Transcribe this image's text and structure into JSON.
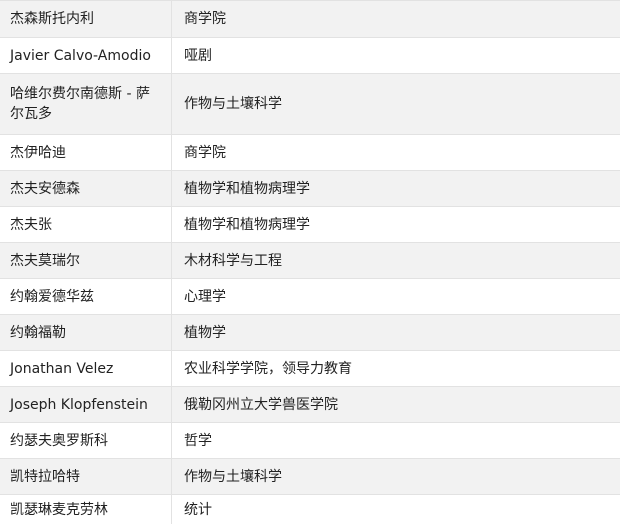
{
  "table": {
    "rows": [
      {
        "name": "杰森斯托内利",
        "dept": "商学院"
      },
      {
        "name": "Javier Calvo-Amodio",
        "dept": "哑剧"
      },
      {
        "name": "哈维尔费尔南德斯 - 萨尔瓦多",
        "dept": "作物与土壤科学"
      },
      {
        "name": "杰伊哈迪",
        "dept": "商学院"
      },
      {
        "name": "杰夫安德森",
        "dept": "植物学和植物病理学"
      },
      {
        "name": "杰夫张",
        "dept": "植物学和植物病理学"
      },
      {
        "name": "杰夫莫瑞尔",
        "dept": "木材科学与工程"
      },
      {
        "name": "约翰爱德华兹",
        "dept": "心理学"
      },
      {
        "name": "约翰福勒",
        "dept": "植物学"
      },
      {
        "name": "Jonathan Velez",
        "dept": "农业科学学院，领导力教育"
      },
      {
        "name": "Joseph Klopfenstein",
        "dept": "俄勒冈州立大学兽医学院"
      },
      {
        "name": "约瑟夫奥罗斯科",
        "dept": "哲学"
      },
      {
        "name": "凯特拉哈特",
        "dept": "作物与土壤科学"
      },
      {
        "name": "凯瑟琳麦克劳林",
        "dept": "统计"
      }
    ]
  }
}
